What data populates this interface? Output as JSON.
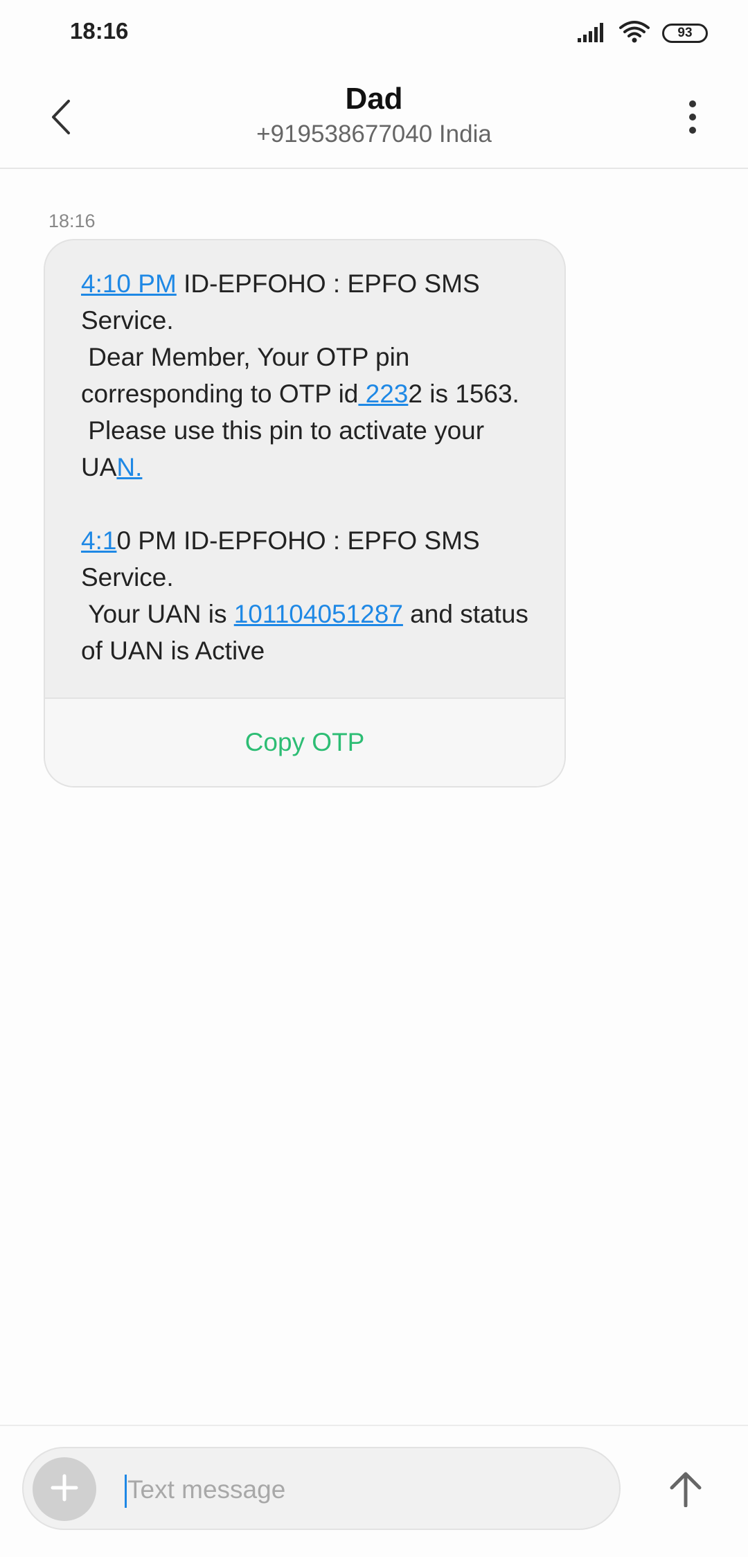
{
  "status_bar": {
    "time": "18:16",
    "battery": "93",
    "icons": [
      "signal-icon",
      "wifi-icon",
      "battery-icon"
    ]
  },
  "header": {
    "contact_name": "Dad",
    "contact_number": "+919538677040 India",
    "icons": [
      "back-arrow-icon",
      "more-vertical-icon"
    ]
  },
  "conversation": {
    "message_time": "18:16",
    "message": {
      "parts": [
        {
          "text": "4:10 PM",
          "link": true
        },
        {
          "text": " ID-EPFOHO : EPFO SMS Service.\n Dear Member, Your OTP pin corresponding to OTP id",
          "link": false
        },
        {
          "text": " 223",
          "link": true
        },
        {
          "text": "2 is 1563.\n Please use this pin to activate your UA",
          "link": false
        },
        {
          "text": "N.",
          "link": true
        },
        {
          "text": "\n\n",
          "link": false
        },
        {
          "text": "4:1",
          "link": true
        },
        {
          "text": "0 PM ID-EPFOHO : EPFO SMS Service.\n Your UAN is ",
          "link": false
        },
        {
          "text": "101104051287",
          "link": true
        },
        {
          "text": " and status of UAN is Active",
          "link": false
        }
      ]
    },
    "action_label": "Copy OTP"
  },
  "composer": {
    "placeholder": "Text message",
    "value": "",
    "icons": [
      "plus-icon",
      "send-arrow-up-icon"
    ]
  },
  "colors": {
    "link": "#1e88e5",
    "action": "#2dbd74",
    "bubble": "#efefef"
  }
}
